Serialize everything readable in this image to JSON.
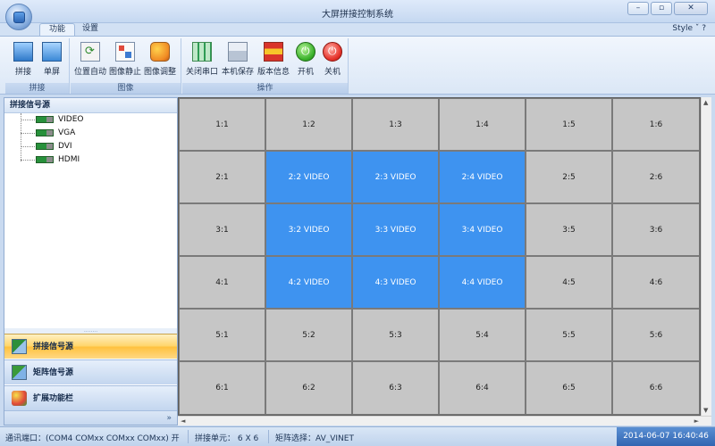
{
  "window": {
    "title": "大屏拼接控制系统",
    "min_glyph": "–",
    "max_glyph": "▫",
    "close_glyph": "✕"
  },
  "tabs": [
    {
      "label": "功能"
    },
    {
      "label": "设置"
    }
  ],
  "style_menu": "Style ˇ ?",
  "ribbon": {
    "groups": [
      {
        "label": "拼接",
        "buttons": [
          {
            "label": "拼接"
          },
          {
            "label": "单屏"
          }
        ]
      },
      {
        "label": "图像",
        "buttons": [
          {
            "label": "位置自动"
          },
          {
            "label": "图像静止"
          },
          {
            "label": "图像调整"
          }
        ]
      },
      {
        "label": "操作",
        "buttons": [
          {
            "label": "关闭串口"
          },
          {
            "label": "本机保存"
          },
          {
            "label": "版本信息"
          },
          {
            "label": "开机"
          },
          {
            "label": "关机"
          }
        ]
      }
    ]
  },
  "left_panel": {
    "header": "拼接信号源",
    "sources": [
      {
        "label": "VIDEO"
      },
      {
        "label": "VGA"
      },
      {
        "label": "DVI"
      },
      {
        "label": "HDMI"
      }
    ],
    "splitter": "........",
    "nav": [
      {
        "label": "拼接信号源"
      },
      {
        "label": "矩阵信号源"
      },
      {
        "label": "扩展功能栏"
      }
    ],
    "footer": "»"
  },
  "grid": {
    "rows": 6,
    "cols": 6,
    "cells": [
      [
        "1:1",
        "1:2",
        "1:3",
        "1:4",
        "1:5",
        "1:6"
      ],
      [
        "2:1",
        "2:2  VIDEO",
        "2:3  VIDEO",
        "2:4  VIDEO",
        "2:5",
        "2:6"
      ],
      [
        "3:1",
        "3:2  VIDEO",
        "3:3  VIDEO",
        "3:4  VIDEO",
        "3:5",
        "3:6"
      ],
      [
        "4:1",
        "4:2  VIDEO",
        "4:3  VIDEO",
        "4:4  VIDEO",
        "4:5",
        "4:6"
      ],
      [
        "5:1",
        "5:2",
        "5:3",
        "5:4",
        "5:5",
        "5:6"
      ],
      [
        "6:1",
        "6:2",
        "6:3",
        "6:4",
        "6:5",
        "6:6"
      ]
    ],
    "active_cells": [
      "2:2",
      "2:3",
      "2:4",
      "3:2",
      "3:3",
      "3:4",
      "4:2",
      "4:3",
      "4:4"
    ],
    "cell_color": "#c6c6c6",
    "active_color": "#3e93f0"
  },
  "scroll": {
    "up": "▲",
    "down": "▼",
    "left": "◄",
    "right": "►"
  },
  "status": {
    "port": "通讯端口：(COM4 COMxx COMxx COMxx)  开",
    "units": "拼接单元： 6 X 6",
    "matrix": "矩阵选择：AV_VINET",
    "datetime": "2014-06-07 16:40:46"
  }
}
